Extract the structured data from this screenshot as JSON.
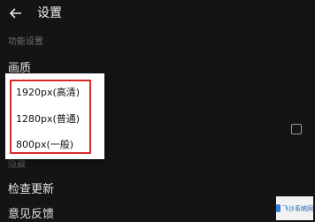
{
  "header": {
    "back_icon": "arrow-left-icon",
    "title": "设置"
  },
  "settings": {
    "section_title": "功能设置",
    "image_quality_label": "画质",
    "faded_label": "隐藏",
    "check_update_label": "检查更新",
    "feedback_label": "意见反馈",
    "checkbox_checked": false
  },
  "quality_dropdown": {
    "options": [
      "1920px(高清)",
      "1280px(普通)",
      "800px(一般)"
    ]
  },
  "watermark": {
    "text": "飞沙系统网"
  }
}
